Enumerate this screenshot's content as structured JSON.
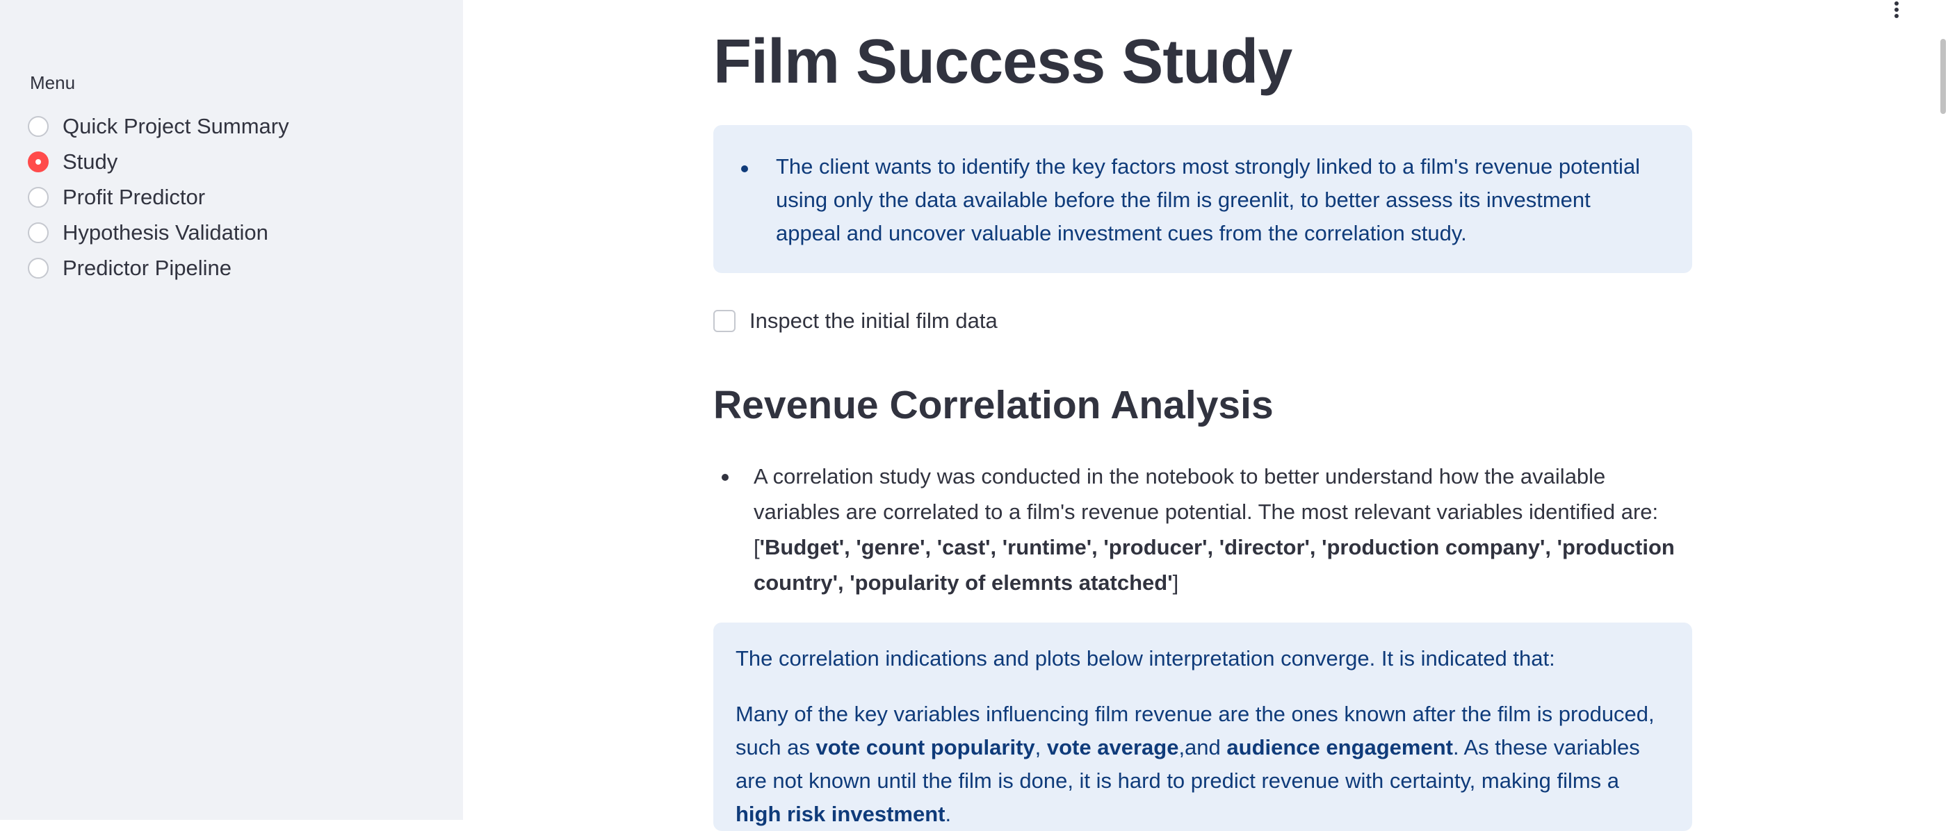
{
  "sidebar": {
    "menu_label": "Menu",
    "items": [
      {
        "label": "Quick Project Summary",
        "selected": false
      },
      {
        "label": "Study",
        "selected": true
      },
      {
        "label": "Profit Predictor",
        "selected": false
      },
      {
        "label": "Hypothesis Validation",
        "selected": false
      },
      {
        "label": "Predictor Pipeline",
        "selected": false
      }
    ]
  },
  "main": {
    "title": "Film Success Study",
    "intro_info": "The client wants to identify the key factors most strongly linked to a film's revenue potential using only the data available before the film is greenlit, to better assess its investment appeal and uncover valuable investment cues from the correlation study.",
    "checkbox_label": "Inspect the initial film data",
    "section_title": "Revenue Correlation Analysis",
    "bullet_text": "A correlation study was conducted in the notebook to better understand how the available variables are correlated to a film's revenue potential. The most relevant variables identified are: [",
    "bullet_vars": "'Budget', 'genre', 'cast', 'runtime', 'producer', 'director', 'production company', 'production country', 'popularity of elemnts atatched'",
    "bullet_end": "]",
    "info2": {
      "line1": "The correlation indications and plots below interpretation converge. It is indicated that:",
      "p2_start": "Many of the key variables influencing film revenue are the ones known after the film is produced, such as ",
      "p2_b1": "vote count popularity",
      "p2_sep1": ", ",
      "p2_b2": "vote average",
      "p2_sep2": ",and ",
      "p2_b3": "audience engagement",
      "p2_mid": ". As these variables are not known until the film is done, it is hard to predict revenue with certainty, making films a ",
      "p2_b4": "high risk investment",
      "p2_end": "."
    }
  },
  "colors": {
    "sidebar_bg": "#f0f2f6",
    "accent": "#ff4b4b",
    "info_bg": "#e8eff9",
    "info_text": "#0f3b7a",
    "text": "#31333f"
  },
  "icons": [
    "kebab-menu-icon"
  ]
}
